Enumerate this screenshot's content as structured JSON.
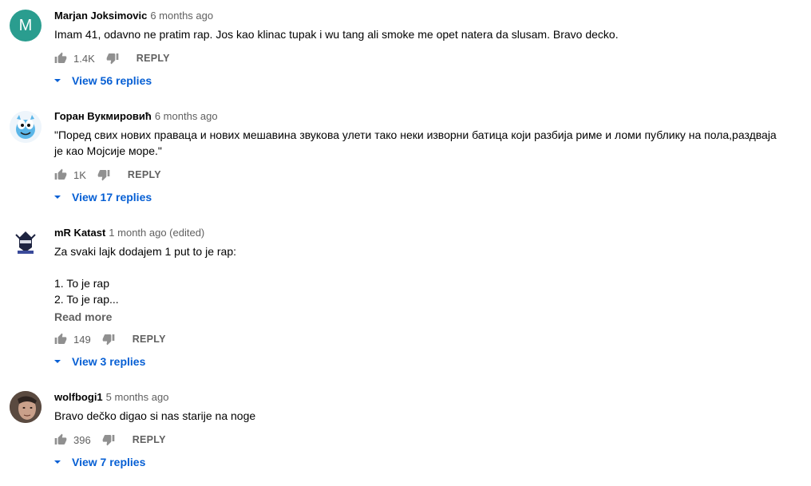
{
  "comments": [
    {
      "author": "Marjan Joksimovic",
      "time": "6 months ago",
      "avatar_letter": "M",
      "lines": [
        "Imam 41, odavno ne pratim rap. Jos kao klinac tupak i wu tang ali smoke me opet natera da slusam. Bravo decko."
      ],
      "likes": "1.4K",
      "reply_label": "REPLY",
      "view_replies": "View 56 replies"
    },
    {
      "author": "Горан Вукмировић",
      "time": "6 months ago",
      "lines": [
        "\"Поред свих нових праваца и нових мешавина звукова улети тако неки изворни батица који разбија риме и ломи публику на пола,раздваја",
        "је као Мојсије море.\""
      ],
      "likes": "1K",
      "reply_label": "REPLY",
      "view_replies": "View 17 replies"
    },
    {
      "author": "mR Katast",
      "time": "1 month ago (edited)",
      "lines": [
        "Za svaki lajk dodajem 1 put to je rap:",
        "",
        "1. To je rap",
        "2. To je rap..."
      ],
      "read_more": "Read more",
      "likes": "149",
      "reply_label": "REPLY",
      "view_replies": "View 3 replies"
    },
    {
      "author": "wolfbogi1",
      "time": "5 months ago",
      "lines": [
        "Bravo dečko digao si nas starije na noge"
      ],
      "likes": "396",
      "reply_label": "REPLY",
      "view_replies": "View 7 replies"
    }
  ],
  "icons": {
    "like": "thumb-up-icon",
    "dislike": "thumb-down-icon",
    "expand": "chevron-down-icon"
  },
  "colors": {
    "link": "#065fd4",
    "secondary": "#606060",
    "avatar_m": "#2a9d8f"
  }
}
